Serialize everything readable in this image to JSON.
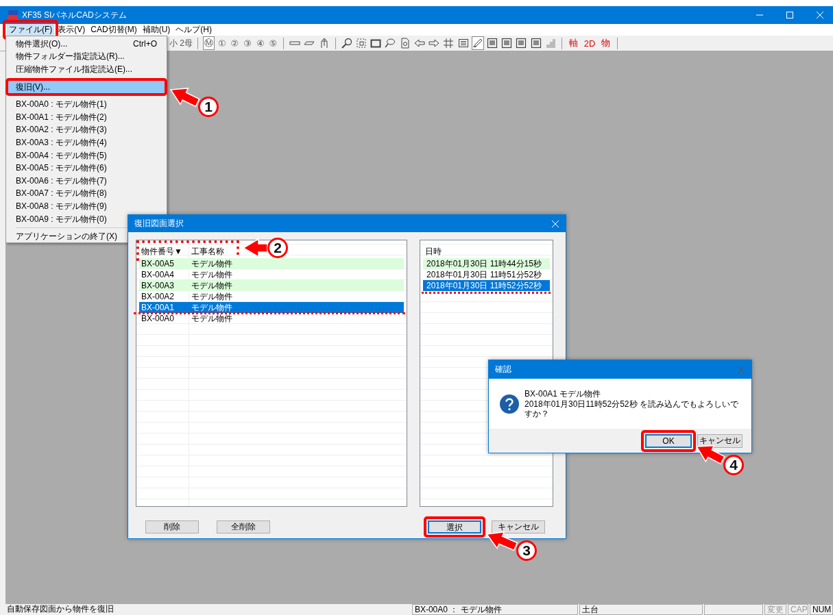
{
  "window": {
    "title": "XF35 SIパネルCADシステム"
  },
  "menubar": [
    {
      "label": "ファイル(F)",
      "selected": true
    },
    {
      "label": "表示(V)",
      "selected": false
    },
    {
      "label": "CAD切替(M)",
      "selected": false
    },
    {
      "label": "補助(U)",
      "selected": false
    },
    {
      "label": "ヘルプ(H)",
      "selected": false
    }
  ],
  "toolbar": {
    "partial_label": "小 2母",
    "mode_buttons": [
      {
        "label": "Ⓜ",
        "selected": true
      },
      {
        "label": "①",
        "selected": false
      },
      {
        "label": "②",
        "selected": false
      },
      {
        "label": "③",
        "selected": false
      },
      {
        "label": "④",
        "selected": false
      },
      {
        "label": "⑤",
        "selected": false
      }
    ],
    "line_tools": [
      {
        "kind": "bar",
        "selected": false
      },
      {
        "kind": "slant",
        "selected": false
      },
      {
        "kind": "post",
        "selected": false
      }
    ],
    "view_tools": [
      {
        "kind": "zoom",
        "selected": false
      },
      {
        "kind": "zoom-area",
        "selected": false
      },
      {
        "kind": "frame",
        "selected": false
      },
      {
        "kind": "lasso",
        "selected": false
      },
      {
        "kind": "page",
        "selected": false
      },
      {
        "kind": "left",
        "selected": false
      },
      {
        "kind": "right",
        "selected": false
      },
      {
        "kind": "grid",
        "selected": false
      },
      {
        "kind": "list",
        "selected": false
      },
      {
        "kind": "pen",
        "selected": true
      },
      {
        "kind": "panel",
        "selected": false
      },
      {
        "kind": "panel",
        "selected": false
      },
      {
        "kind": "panel",
        "selected": false
      },
      {
        "kind": "panel",
        "selected": false
      },
      {
        "kind": "block",
        "selected": false,
        "disabled": true
      }
    ],
    "red_buttons": [
      "軸",
      "2D",
      "物"
    ]
  },
  "file_menu": [
    {
      "kind": "item",
      "label": "物件選択(O)...",
      "shortcut": "Ctrl+O",
      "selected": false
    },
    {
      "kind": "item",
      "label": "物件フォルダー指定読込(R)...",
      "selected": false
    },
    {
      "kind": "item",
      "label": "圧縮物件ファイル指定読込(E)...",
      "selected": false
    },
    {
      "kind": "separator"
    },
    {
      "kind": "item",
      "label": "復旧(V)...",
      "selected": true
    },
    {
      "kind": "separator"
    },
    {
      "kind": "item",
      "label": "BX-00A0 : モデル物件(1)",
      "selected": false
    },
    {
      "kind": "item",
      "label": "BX-00A1 : モデル物件(2)",
      "selected": false
    },
    {
      "kind": "item",
      "label": "BX-00A2 : モデル物件(3)",
      "selected": false
    },
    {
      "kind": "item",
      "label": "BX-00A3 : モデル物件(4)",
      "selected": false
    },
    {
      "kind": "item",
      "label": "BX-00A4 : モデル物件(5)",
      "selected": false
    },
    {
      "kind": "item",
      "label": "BX-00A5 : モデル物件(6)",
      "selected": false
    },
    {
      "kind": "item",
      "label": "BX-00A6 : モデル物件(7)",
      "selected": false
    },
    {
      "kind": "item",
      "label": "BX-00A7 : モデル物件(8)",
      "selected": false
    },
    {
      "kind": "item",
      "label": "BX-00A8 : モデル物件(9)",
      "selected": false
    },
    {
      "kind": "item",
      "label": "BX-00A9 : モデル物件(0)",
      "selected": false
    },
    {
      "kind": "separator"
    },
    {
      "kind": "item",
      "label": "アプリケーションの終了(X)",
      "selected": false
    }
  ],
  "restore_dialog": {
    "title": "復旧図面選択",
    "columns": [
      "物件番号▼",
      "工事名称"
    ],
    "rows": [
      {
        "cells": [
          "BX-00A5",
          "モデル物件"
        ],
        "selected": false
      },
      {
        "cells": [
          "BX-00A4",
          "モデル物件"
        ],
        "selected": false
      },
      {
        "cells": [
          "BX-00A3",
          "モデル物件"
        ],
        "selected": false
      },
      {
        "cells": [
          "BX-00A2",
          "モデル物件"
        ],
        "selected": false
      },
      {
        "cells": [
          "BX-00A1",
          "モデル物件"
        ],
        "selected": true
      },
      {
        "cells": [
          "BX-00A0",
          "モデル物件"
        ],
        "selected": false
      }
    ],
    "date_column": "日時",
    "dates": [
      {
        "text": "2018年01月30日 11時44分15秒",
        "selected": false
      },
      {
        "text": "2018年01月30日 11時51分52秒",
        "selected": false
      },
      {
        "text": "2018年01月30日 11時52分52秒",
        "selected": true
      }
    ],
    "left_buttons": [
      "削除",
      "全削除"
    ],
    "right_buttons": [
      {
        "label": "選択",
        "default": true
      },
      {
        "label": "キャンセル",
        "default": false
      }
    ]
  },
  "confirm_dialog": {
    "title": "確認",
    "message_lines": [
      "BX-00A1 モデル物件",
      "2018年01月30日11時52分52秒 を読み込んでもよろしいですか？"
    ],
    "buttons": [
      {
        "label": "OK",
        "default": true
      },
      {
        "label": "キャンセル",
        "default": false
      }
    ]
  },
  "status_bar": [
    {
      "text": "自動保存図面から物件を復旧",
      "disabled": false
    },
    {
      "text": "BX-00A0 ： モデル物件",
      "disabled": false
    },
    {
      "text": "土台",
      "disabled": false
    },
    {
      "text": "変更",
      "disabled": true
    },
    {
      "text": "CAP",
      "disabled": true
    },
    {
      "text": "NUM",
      "disabled": false
    }
  ],
  "annotations": [
    {
      "label": "1"
    },
    {
      "label": "2"
    },
    {
      "label": "3"
    },
    {
      "label": "4"
    }
  ]
}
